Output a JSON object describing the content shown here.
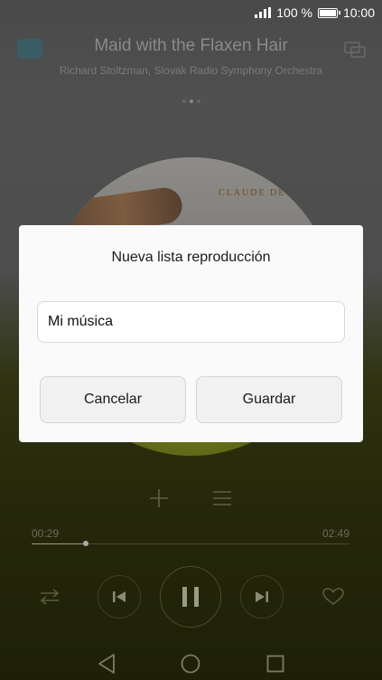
{
  "status_bar": {
    "battery_text": "100 %",
    "time": "10:00"
  },
  "player": {
    "title": "Maid with the Flaxen Hair",
    "artist": "Richard Stoltzman, Slovak Radio Symphony Orchestra",
    "album_art_text": "CLAUDE DE",
    "time_current": "00:29",
    "time_total": "02:49",
    "progress": 0.17
  },
  "dialog": {
    "title": "Nueva lista reproducción",
    "input_value": "Mi música",
    "cancel_label": "Cancelar",
    "save_label": "Guardar"
  },
  "icons": {
    "app": "music-app-icon",
    "cast": "cast-icon",
    "add": "add-icon",
    "queue": "queue-list-icon",
    "shuffle": "shuffle-icon",
    "prev": "skip-previous-icon",
    "pause": "pause-icon",
    "next": "skip-next-icon",
    "favorite": "heart-icon",
    "nav_back": "back-icon",
    "nav_home": "home-icon",
    "nav_recents": "recents-icon"
  }
}
